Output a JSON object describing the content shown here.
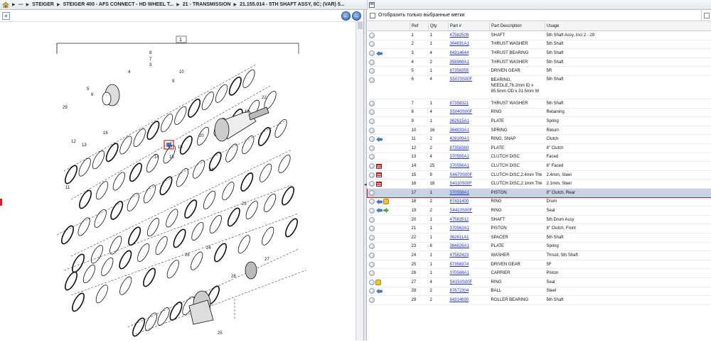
{
  "breadcrumb": {
    "items": [
      "---",
      "STEIGER",
      "STEIGER 400 - AFS CONNECT - HD WHEEL T...",
      "21 - TRANSMISSION",
      "21.155.014 - 5TH SHAFT ASSY, 8C; (VAR) 5..."
    ]
  },
  "nav": {
    "back": "←",
    "forward": "→"
  },
  "left_toolbar": {
    "tool_icon": "print-icon"
  },
  "diagram": {
    "frame_label": "1",
    "callouts": [
      "1",
      "2",
      "3",
      "4",
      "5",
      "6",
      "7",
      "8",
      "9",
      "10",
      "11",
      "12",
      "13",
      "14",
      "15",
      "16",
      "17",
      "18",
      "19",
      "20",
      "21",
      "22",
      "23",
      "24",
      "25",
      "26",
      "27",
      "28",
      "29"
    ]
  },
  "options": {
    "show_selected_label": "Отобразить только выбранные метки"
  },
  "table": {
    "headers": [
      "",
      "Ref",
      "Qty",
      "Part #",
      "Part Description",
      "Usage"
    ],
    "rows": [
      {
        "ref": "1",
        "qty": "1",
        "part": "47582509",
        "desc": "SHAFT",
        "usage": "5th Shaft Assy, Incl 2 - 29",
        "icons": []
      },
      {
        "ref": "2",
        "qty": "1",
        "part": "364831A1",
        "desc": "THRUST WASHER",
        "usage": "5th Shaft",
        "icons": []
      },
      {
        "ref": "3",
        "qty": "4",
        "part": "84314644",
        "desc": "THRUST BEARING",
        "usage": "5th Shaft",
        "icons": [
          "blue"
        ]
      },
      {
        "ref": "4",
        "qty": "2",
        "part": "358968A1",
        "desc": "THRUST WASHER",
        "usage": "5th Shaft",
        "icons": []
      },
      {
        "ref": "5",
        "qty": "1",
        "part": "87358355",
        "desc": "DRIVEN GEAR",
        "usage": "5R",
        "icons": []
      },
      {
        "ref": "6",
        "qty": "4",
        "part": "S5070S00F",
        "desc": "BEARING, NEEDLE,76.2mm ID x 85.5mm OD x 31.5mm W",
        "usage": "5th Shaft",
        "icons": []
      },
      {
        "ref": "7",
        "qty": "1",
        "part": "87358321",
        "desc": "THRUST WASHER",
        "usage": "5th Shaft",
        "icons": []
      },
      {
        "ref": "8",
        "qty": "4",
        "part": "S5040S00F",
        "desc": "RING",
        "usage": "Retaining",
        "icons": []
      },
      {
        "ref": "9",
        "qty": "1",
        "part": "362615A1",
        "desc": "PLATE",
        "usage": "Spring",
        "icons": []
      },
      {
        "ref": "10",
        "qty": "16",
        "part": "364833A1",
        "desc": "SPRING",
        "usage": "Return",
        "icons": []
      },
      {
        "ref": "11",
        "qty": "2",
        "part": "428109A1",
        "desc": "RING, SNAP",
        "usage": "Clutch",
        "icons": [
          "blue"
        ]
      },
      {
        "ref": "12",
        "qty": "2",
        "part": "87358360",
        "desc": "PLATE",
        "usage": "8\" Clutch",
        "icons": []
      },
      {
        "ref": "13",
        "qty": "4",
        "part": "370555A1",
        "desc": "CLUTCH DISC",
        "usage": "Faced",
        "icons": []
      },
      {
        "ref": "14",
        "qty": "25",
        "part": "370556A1",
        "desc": "CLUTCH DISC",
        "usage": "8\" Faced",
        "icons": [
          "red"
        ]
      },
      {
        "ref": "15",
        "qty": "9",
        "part": "S4670S00F",
        "desc": "CLUTCH DISC,2.4mm Thk",
        "usage": "2.4mm, Steel",
        "icons": [
          "red"
        ]
      },
      {
        "ref": "16",
        "qty": "18",
        "part": "S4110S00F",
        "desc": "CLUTCH DISC,2.1mm Thk",
        "usage": "2.1mm, Steel",
        "icons": [
          "red"
        ]
      },
      {
        "ref": "17",
        "qty": "1",
        "part": "370558A1",
        "desc": "PISTON",
        "usage": "8\" Clutch, Rear",
        "icons": [],
        "selected": true
      },
      {
        "ref": "18",
        "qty": "2",
        "part": "87431400",
        "desc": "RING",
        "usage": "Drum",
        "icons": [
          "blue",
          "yellow"
        ]
      },
      {
        "ref": "19",
        "qty": "2",
        "part": "S4410S00F",
        "desc": "RING",
        "usage": "Seal",
        "icons": [
          "blue",
          "green"
        ]
      },
      {
        "ref": "20",
        "qty": "1",
        "part": "47582512",
        "desc": "SHAFT",
        "usage": "5th Drum Assy",
        "icons": []
      },
      {
        "ref": "21",
        "qty": "1",
        "part": "370562A1",
        "desc": "PISTON",
        "usage": "8\" Clutch, Front",
        "icons": []
      },
      {
        "ref": "22",
        "qty": "1",
        "part": "362611A1",
        "desc": "SPACER",
        "usage": "5th Shaft",
        "icons": []
      },
      {
        "ref": "23",
        "qty": "8",
        "part": "364826A1",
        "desc": "PLATE",
        "usage": "Spring",
        "icons": []
      },
      {
        "ref": "24",
        "qty": "1",
        "part": "47582423",
        "desc": "WASHER",
        "usage": "Thrust, 5th Shaft",
        "icons": []
      },
      {
        "ref": "25",
        "qty": "1",
        "part": "87358374",
        "desc": "DRIVEN GEAR",
        "usage": "5F",
        "icons": []
      },
      {
        "ref": "26",
        "qty": "1",
        "part": "370568A1",
        "desc": "CARRIER",
        "usage": "Piston",
        "icons": []
      },
      {
        "ref": "27",
        "qty": "4",
        "part": "S4150S00F",
        "desc": "RING",
        "usage": "Seal",
        "icons": [
          "yellow"
        ]
      },
      {
        "ref": "28",
        "qty": "2",
        "part": "87672304",
        "desc": "BALL",
        "usage": "Steel",
        "icons": [
          "blue"
        ]
      },
      {
        "ref": "29",
        "qty": "2",
        "part": "84314690",
        "desc": "ROLLER BEARING",
        "usage": "5th Shaft",
        "icons": []
      }
    ]
  },
  "colors": {
    "link": "#1d2fd1",
    "selection": "#c8d3e4",
    "highlight": "#d3191a"
  }
}
